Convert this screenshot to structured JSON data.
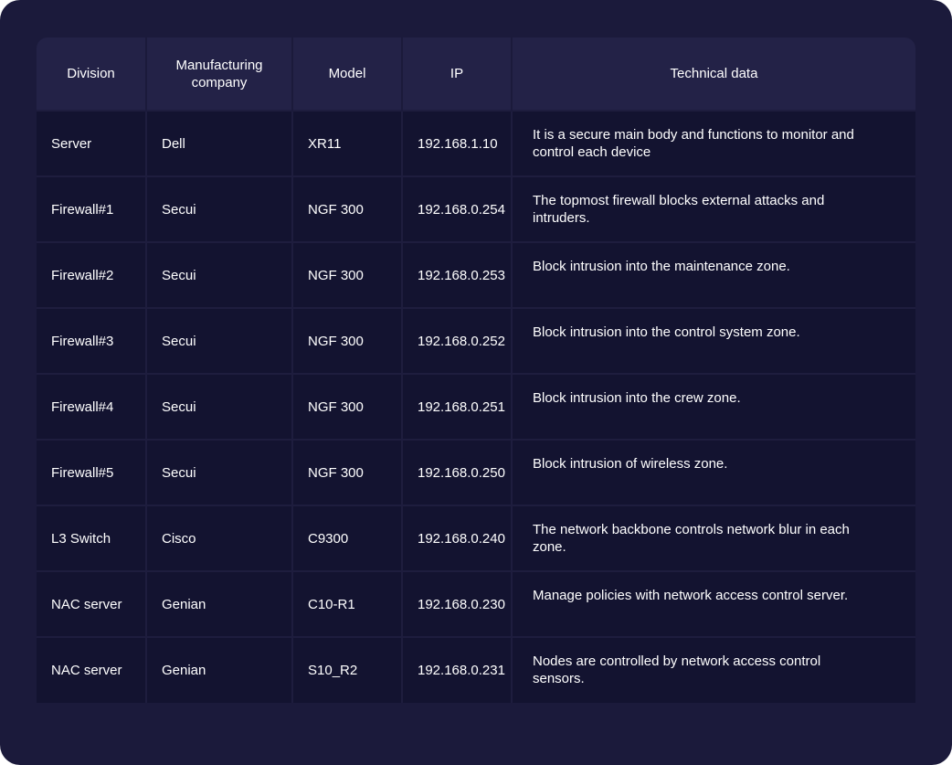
{
  "table": {
    "headers": [
      "Division",
      "Manufacturing company",
      "Model",
      "IP",
      "Technical data"
    ],
    "rows": [
      {
        "division": "Server",
        "company": "Dell",
        "model": "XR11",
        "ip": "192.168.1.10",
        "tech": "It is a secure main body and functions to monitor and control each device"
      },
      {
        "division": "Firewall#1",
        "company": "Secui",
        "model": "NGF 300",
        "ip": "192.168.0.254",
        "tech": "The topmost firewall blocks external attacks and intruders."
      },
      {
        "division": "Firewall#2",
        "company": "Secui",
        "model": "NGF 300",
        "ip": "192.168.0.253",
        "tech": "Block intrusion into the maintenance zone."
      },
      {
        "division": "Firewall#3",
        "company": "Secui",
        "model": "NGF 300",
        "ip": "192.168.0.252",
        "tech": "Block intrusion into the control system zone."
      },
      {
        "division": "Firewall#4",
        "company": "Secui",
        "model": "NGF 300",
        "ip": "192.168.0.251",
        "tech": "Block intrusion into the crew zone."
      },
      {
        "division": "Firewall#5",
        "company": "Secui",
        "model": "NGF 300",
        "ip": "192.168.0.250",
        "tech": "Block intrusion of wireless zone."
      },
      {
        "division": "L3 Switch",
        "company": "Cisco",
        "model": "C9300",
        "ip": "192.168.0.240",
        "tech": "The network backbone controls network blur in each zone."
      },
      {
        "division": "NAC server",
        "company": "Genian",
        "model": "C10-R1",
        "ip": "192.168.0.230",
        "tech": "Manage policies with network access control server."
      },
      {
        "division": "NAC server",
        "company": "Genian",
        "model": "S10_R2",
        "ip": "192.168.0.231",
        "tech": "Nodes are controlled by network access control sensors."
      }
    ]
  },
  "colors": {
    "background": "#1b1a3b",
    "header_background": "#232247",
    "row_background": "#131330",
    "text": "#ffffff"
  }
}
